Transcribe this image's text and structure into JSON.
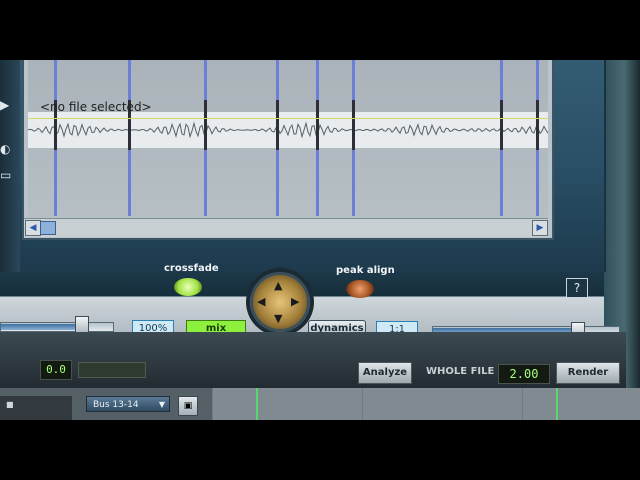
{
  "waveform": {
    "placeholder": "<no file selected>"
  },
  "controls": {
    "crossfade_label": "crossfade",
    "peak_align_label": "peak align",
    "percent_value": "100%",
    "mix_label": "mix",
    "dynamics_label": "dynamics",
    "ratio_value": "1:1",
    "help_label": "?",
    "joystick_up": "▲",
    "joystick_down": "▼",
    "joystick_left": "◀",
    "joystick_right": "▶",
    "left_slider_level": 0.78,
    "right_slider_level": 0.78
  },
  "footer": {
    "left_readout": "0.0",
    "analyze_label": "Analyze",
    "scope_label": "WHOLE FILE",
    "value_readout": "2.00",
    "render_label": "Render"
  },
  "daw": {
    "bus_label": "Bus 13-14",
    "bus_dropdown_arrow": "▼",
    "bus_button_icon": "▣"
  },
  "colors": {
    "crossfade_led": "#b8f060",
    "peak_align_led": "#a0521f",
    "mix_button": "#8cf03c",
    "readout_green": "#a5ff7a"
  }
}
